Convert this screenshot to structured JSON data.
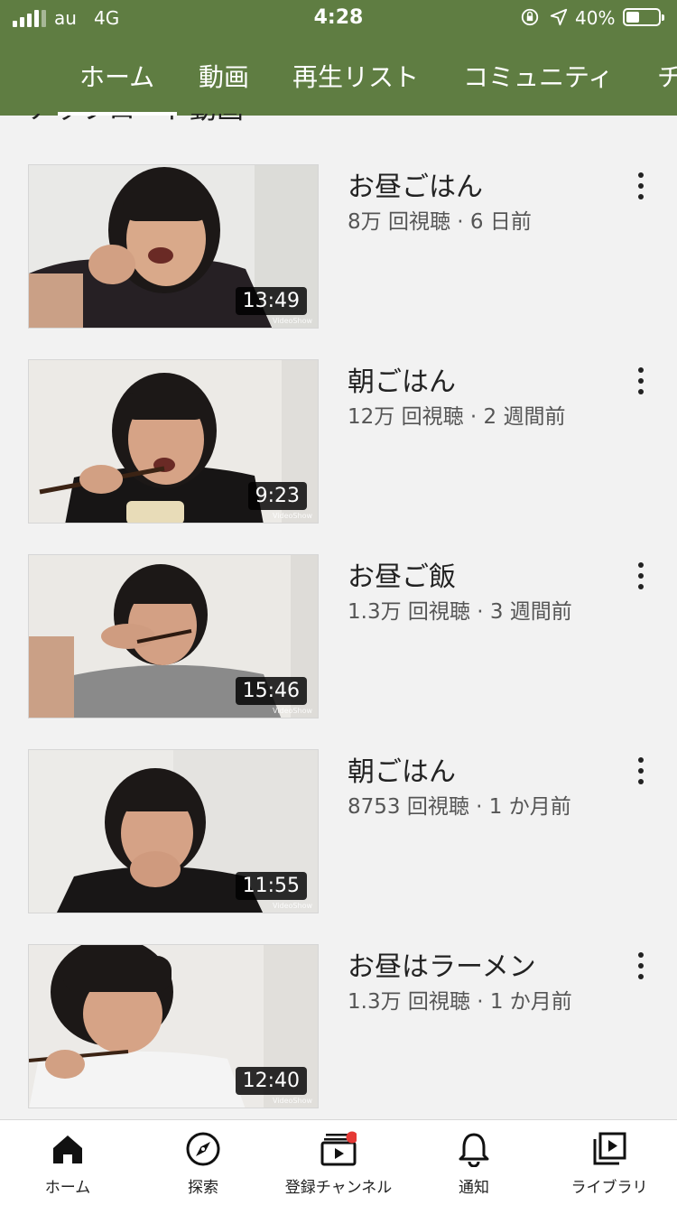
{
  "status_bar": {
    "carrier": "au",
    "network": "4G",
    "time": "4:28",
    "battery": "40%"
  },
  "tabs": [
    {
      "label": "ホーム",
      "active": true
    },
    {
      "label": "動画"
    },
    {
      "label": "再生リスト"
    },
    {
      "label": "コミュニティ"
    },
    {
      "label": "チ"
    }
  ],
  "section": {
    "title": "アップロード動画"
  },
  "videos": [
    {
      "title": "お昼ごはん",
      "views": "8万 回視聴",
      "age": "6 日前",
      "meta": "8万 回視聴 · 6 日前",
      "duration": "13:49",
      "watermark": "VideoShow"
    },
    {
      "title": "朝ごはん",
      "views": "12万 回視聴",
      "age": "2 週間前",
      "meta": "12万 回視聴 · 2 週間前",
      "duration": "9:23",
      "watermark": "VideoShow"
    },
    {
      "title": "お昼ご飯",
      "views": "1.3万 回視聴",
      "age": "3 週間前",
      "meta": "1.3万 回視聴 · 3 週間前",
      "duration": "15:46",
      "watermark": "VideoShow"
    },
    {
      "title": "朝ごはん",
      "views": "8753 回視聴",
      "age": "1 か月前",
      "meta": "8753 回視聴 · 1 か月前",
      "duration": "11:55",
      "watermark": "VideoShow"
    },
    {
      "title": "お昼はラーメン",
      "views": "1.3万 回視聴",
      "age": "1 か月前",
      "meta": "1.3万 回視聴 · 1 か月前",
      "duration": "12:40",
      "watermark": "VideoShow"
    }
  ],
  "bottom_nav": [
    {
      "label": "ホーム",
      "icon": "home-icon"
    },
    {
      "label": "探索",
      "icon": "explore-icon"
    },
    {
      "label": "登録チャンネル",
      "icon": "subscriptions-icon"
    },
    {
      "label": "通知",
      "icon": "bell-icon"
    },
    {
      "label": "ライブラリ",
      "icon": "library-icon"
    }
  ],
  "colors": {
    "header": "#5f7d42",
    "notification_dot": "#e53935"
  }
}
